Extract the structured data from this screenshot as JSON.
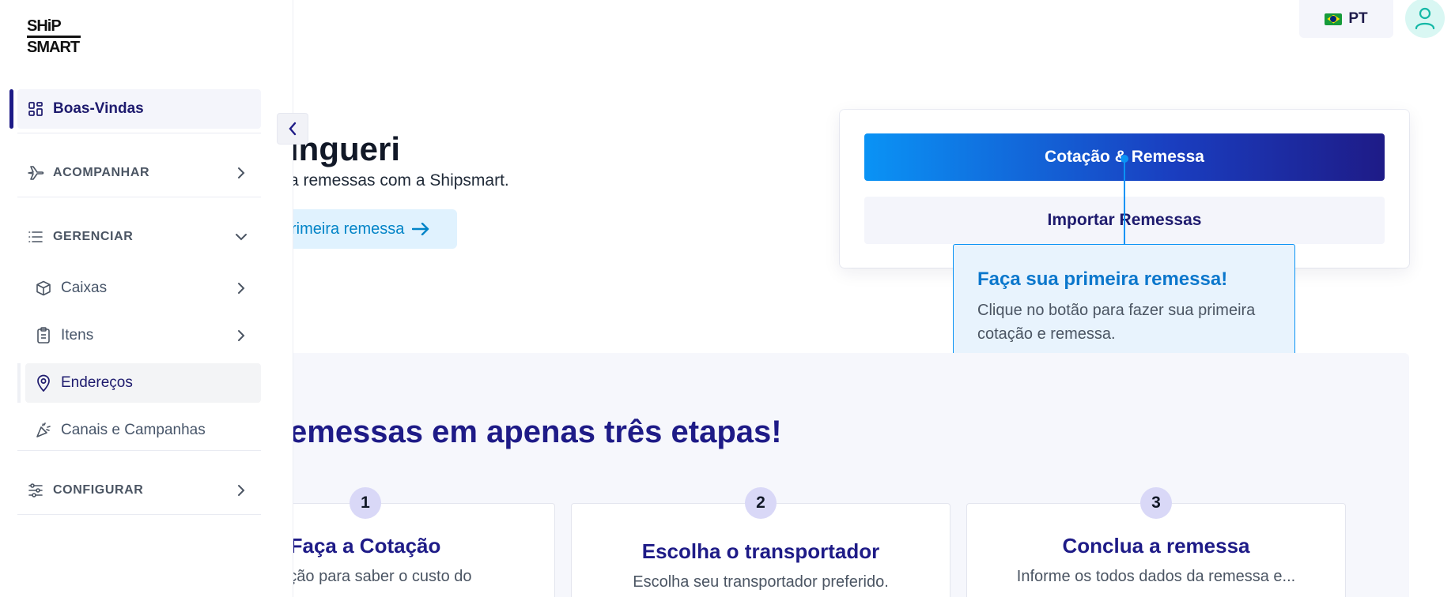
{
  "header": {
    "language": "PT"
  },
  "hero": {
    "title": "ingueri",
    "subtitle": "a remessas com a Shipsmart.",
    "cta_label": "rimeira remessa"
  },
  "actions": {
    "quote_button": "Cotação & Remessa",
    "import_button": "Importar Remessas"
  },
  "tooltip": {
    "title": "Faça sua primeira remessa!",
    "text": "Clique no botão para fazer sua primeira cotação e remessa."
  },
  "steps": {
    "title": "emessas em apenas três etapas!",
    "items": [
      {
        "number": "1",
        "title": "Faça a Cotação",
        "text": "cotação para saber o custo do"
      },
      {
        "number": "2",
        "title": "Escolha o transportador",
        "text": "Escolha seu transportador preferido."
      },
      {
        "number": "3",
        "title": "Conclua a remessa",
        "text": "Informe os todos dados da remessa e..."
      }
    ]
  },
  "sidebar": {
    "logo_top": "SHiP",
    "logo_bottom": "SMART",
    "items": [
      {
        "label": "Boas-Vindas",
        "icon": "dashboard-icon"
      },
      {
        "label": "ACOMPANHAR",
        "icon": "airplane-icon"
      },
      {
        "label": "GERENCIAR",
        "icon": "list-icon"
      },
      {
        "label": "Caixas",
        "icon": "box-icon"
      },
      {
        "label": "Itens",
        "icon": "clipboard-icon"
      },
      {
        "label": "Endereços",
        "icon": "location-pin-icon"
      },
      {
        "label": "Canais e Campanhas",
        "icon": "party-popper-icon"
      },
      {
        "label": "CONFIGURAR",
        "icon": "sliders-icon"
      }
    ]
  },
  "colors": {
    "brand_navy": "#1e1b87",
    "brand_blue": "#0a93f5",
    "sidebar_bg": "#ffffff",
    "soft_bg": "#f4f5fb"
  }
}
